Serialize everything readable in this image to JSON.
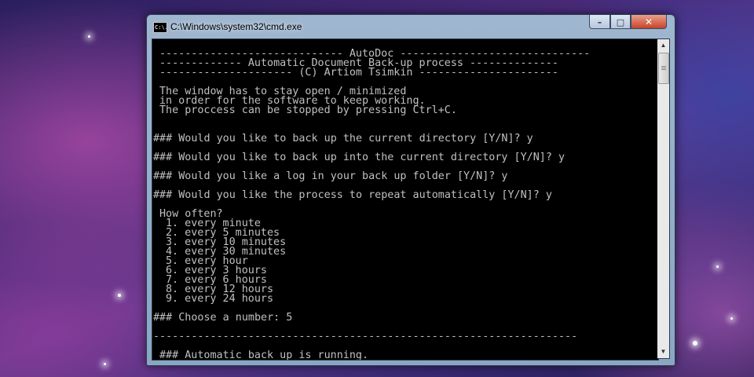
{
  "window": {
    "title": "C:\\Windows\\system32\\cmd.exe",
    "icon_text": "C:\\.",
    "minimize_glyph": "–",
    "maximize_glyph": "□",
    "close_glyph": "✕"
  },
  "console": {
    "lines": [
      "----------------------------- AutoDoc ------------------------------",
      "------------- Automatic Document Back-up process --------------",
      "--------------------- (C) Artiom Tsimkin ----------------------",
      "The window has to stay open / minimized",
      "in order for the software to keep working.",
      "The proccess can be stopped by pressing Ctrl+C.",
      "### Would you like to back up the current directory [Y/N]? y",
      "### Would you like to back up into the current directory [Y/N]? y",
      "### Would you like a log in your back up folder [Y/N]? y",
      "### Would you like the process to repeat automatically [Y/N]? y",
      "How often?",
      "1. every minute",
      "2. every 5 minutes",
      "3. every 10 minutes",
      "4. every 30 minutes",
      "5. every hour",
      "6. every 3 hours",
      "7. every 6 hours",
      "8. every 12 hours",
      "9. every 24 hours",
      "### Choose a number: 5",
      "-------------------------------------------------------------------",
      "### Automatic back up is running."
    ]
  },
  "scrollbar": {
    "up_glyph": "▲",
    "down_glyph": "▼"
  }
}
